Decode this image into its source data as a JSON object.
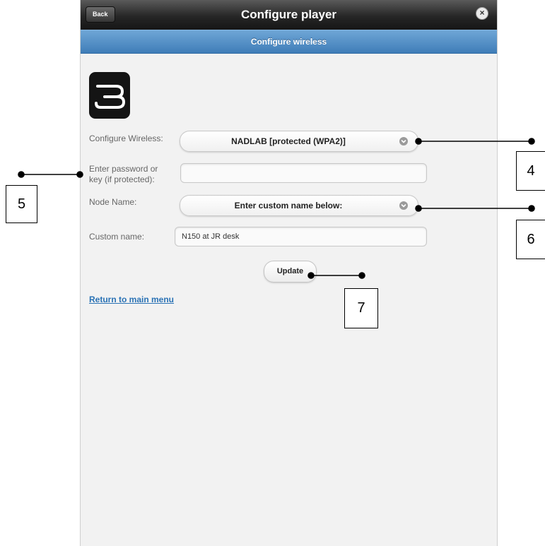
{
  "header": {
    "back_label": "Back",
    "title": "Configure player",
    "close_icon": "close-circle-icon"
  },
  "subheader": {
    "title": "Configure wireless"
  },
  "logo": {
    "icon": "bluos-logo-icon"
  },
  "form": {
    "wireless_label": "Configure Wireless:",
    "wireless_value": "NADLAB [protected (WPA2)]",
    "password_label_line1": "Enter password or",
    "password_label_line2": "key (if protected):",
    "password_value": "",
    "node_label": "Node Name:",
    "node_value": "Enter custom name below:",
    "custom_label": "Custom name:",
    "custom_value": "N150 at JR desk",
    "update_label": "Update"
  },
  "return_link": "Return to main menu",
  "callouts": {
    "c4": "4",
    "c5": "5",
    "c6": "6",
    "c7": "7"
  },
  "colors": {
    "header_dark": "#262626",
    "subheader_blue": "#4a86c0",
    "link_blue": "#2a72b5"
  }
}
